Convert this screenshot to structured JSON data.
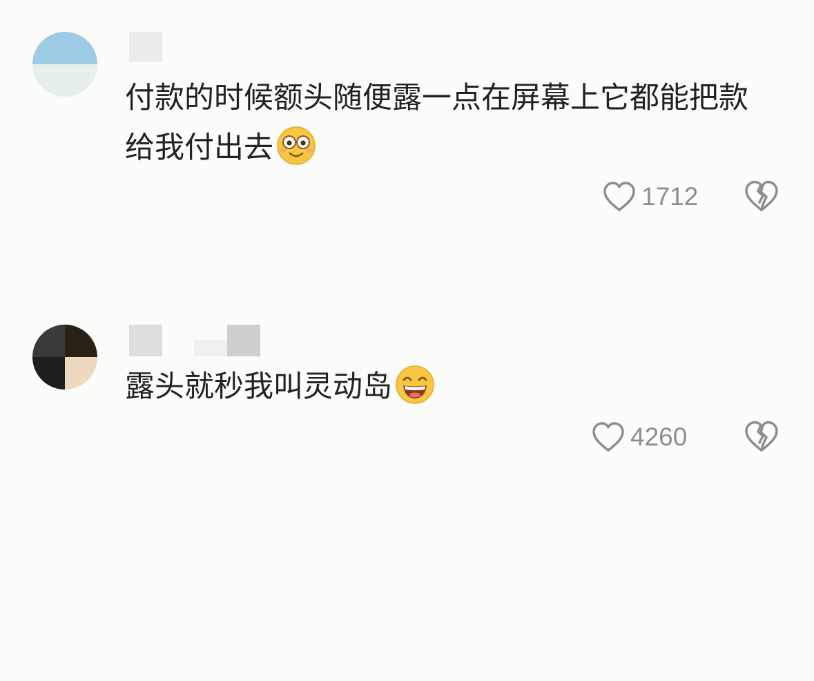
{
  "comments": [
    {
      "text": "付款的时候额头随便露一点在屏幕上它都能把款给我付出去",
      "emoji": "flushed-smile-emoji",
      "likes": "1712",
      "avatar_colors": [
        "#9dcbe6",
        "#e7efec"
      ],
      "icons": {
        "like": "heart-outline-icon",
        "dislike": "broken-heart-icon"
      }
    },
    {
      "text": "露头就秒我叫灵动岛",
      "emoji": "grinning-emoji",
      "likes": "4260",
      "avatar_colors": [
        "#3a3a3a",
        "#2a2116",
        "#1e1e1e",
        "#eed9c0"
      ],
      "icons": {
        "like": "heart-outline-icon",
        "dislike": "broken-heart-icon"
      }
    }
  ],
  "colors": {
    "background": "#fcfcfa",
    "text": "#222222",
    "meta": "#8d8d8d",
    "emoji_face": "#f7c643"
  }
}
